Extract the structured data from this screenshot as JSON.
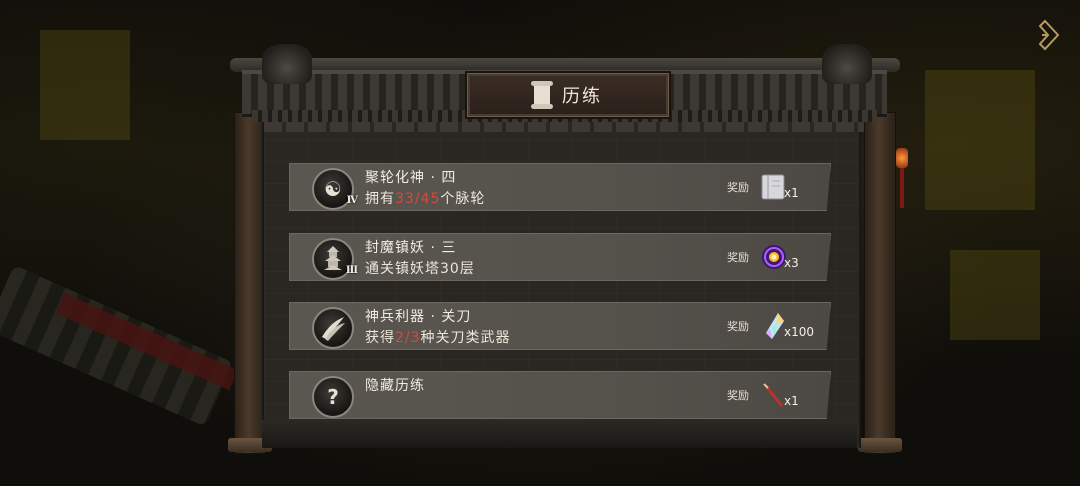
{
  "title": "历练",
  "reward_label": "奖励",
  "quests": [
    {
      "title": "聚轮化神 · 四",
      "desc_prefix": "拥有",
      "desc_highlight": "33/45",
      "desc_suffix": "个脉轮",
      "tier": "Ⅳ",
      "icon": "yin-yang-icon",
      "reward_icon": "book-icon",
      "reward_qty": "x1"
    },
    {
      "title": "封魔镇妖 · 三",
      "desc_prefix": "通关镇妖塔30层",
      "desc_highlight": "",
      "desc_suffix": "",
      "tier": "Ⅲ",
      "icon": "pagoda-icon",
      "reward_icon": "orb-icon",
      "reward_qty": "x3"
    },
    {
      "title": "神兵利器 · 关刀",
      "desc_prefix": "获得",
      "desc_highlight": "2/3",
      "desc_suffix": "种关刀类武器",
      "tier": "",
      "icon": "blade-icon",
      "reward_icon": "crystal-icon",
      "reward_qty": "x100"
    },
    {
      "title": "隐藏历练",
      "desc_prefix": "",
      "desc_highlight": "",
      "desc_suffix": "",
      "tier": "",
      "icon": "question-icon",
      "reward_icon": "red-blade-icon",
      "reward_qty": "x1"
    }
  ],
  "colors": {
    "highlight": "#d64a3a",
    "panel": "#2a2722",
    "row": "#55514b"
  }
}
